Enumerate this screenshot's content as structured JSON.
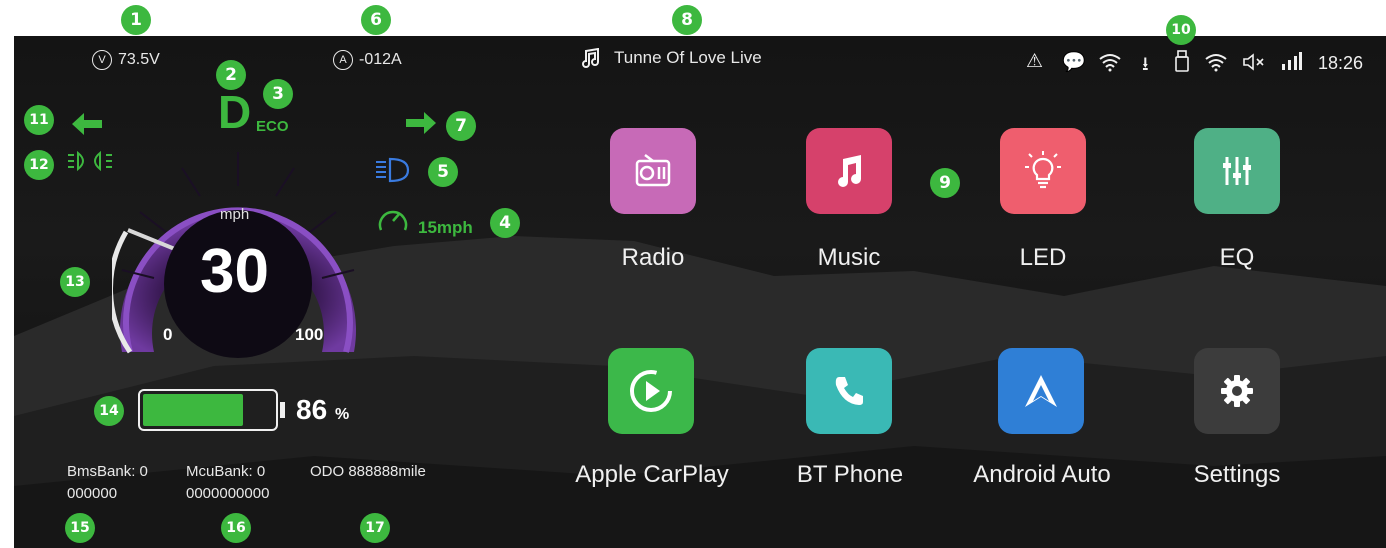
{
  "callouts": [
    "1",
    "2",
    "3",
    "4",
    "5",
    "6",
    "7",
    "8",
    "9",
    "10",
    "11",
    "12",
    "13",
    "14",
    "15",
    "16",
    "17"
  ],
  "header": {
    "voltage_icon": "V",
    "voltage": "73.5V",
    "current_icon": "A",
    "current": "-012A",
    "song": "Tunne Of Love Live",
    "time": "18:26"
  },
  "dash": {
    "gear": "D",
    "mode": "ECO",
    "speed_limit": "15mph",
    "unit": "mph",
    "speed": "30",
    "gauge_min": "0",
    "gauge_max": "100",
    "battery_percent": "86",
    "percent_sign": "%",
    "battery_fill_fraction": 0.77
  },
  "info": {
    "bms_label": "BmsBank: 0",
    "bms_value": "000000",
    "mcu_label": "McuBank: 0",
    "mcu_value": "0000000000",
    "odo": "ODO 888888mile"
  },
  "apps": [
    {
      "label": "Radio",
      "icon": "radio-icon",
      "color": "#c76ab7"
    },
    {
      "label": "Music",
      "icon": "music-note-icon",
      "color": "#d6416b"
    },
    {
      "label": "LED",
      "icon": "lightbulb-icon",
      "color": "#ef5e6e"
    },
    {
      "label": "EQ",
      "icon": "equalizer-icon",
      "color": "#4fb086"
    },
    {
      "label": "Apple CarPlay",
      "icon": "carplay-icon",
      "color": "#3cb84a"
    },
    {
      "label": "BT Phone",
      "icon": "phone-icon",
      "color": "#3ab9b5"
    },
    {
      "label": "Android Auto",
      "icon": "android-auto-icon",
      "color": "#2f7fd6"
    },
    {
      "label": "Settings",
      "icon": "gear-icon",
      "color": "#3c3c3c"
    }
  ],
  "colors": {
    "green": "#3db83f",
    "purple": "#7b3fb0",
    "blue": "#3a7be0"
  }
}
